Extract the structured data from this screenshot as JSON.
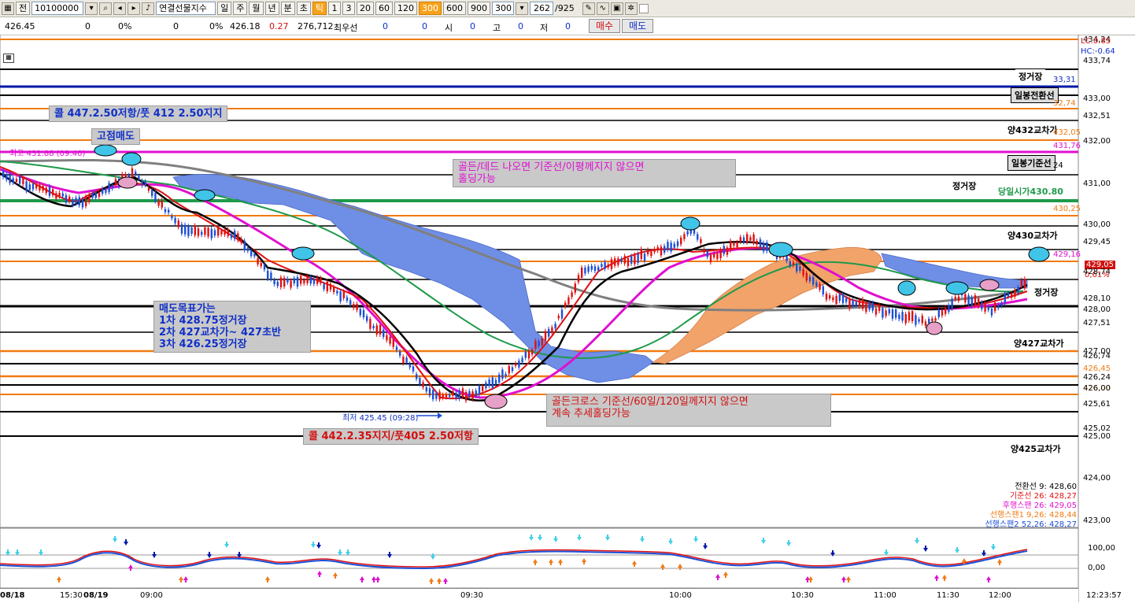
{
  "toolbar": {
    "items": [
      "전",
      "일",
      "주",
      "월",
      "년",
      "분",
      "초",
      "틱",
      "1",
      "3",
      "20",
      "60",
      "120",
      "300",
      "600",
      "900"
    ],
    "active_item": "300",
    "code_value": "10100000",
    "instrument_name": "연결선물지수",
    "interval_value": "300",
    "count_value": "262",
    "count_total": "/925"
  },
  "quote": {
    "price": "426.45",
    "v1": "0",
    "p1": "0%",
    "v2": "0",
    "p2": "0%",
    "price2": "426.18",
    "change": "0.27",
    "volume": "276,712",
    "label_best": "최우선",
    "best_a": "0",
    "best_b": "0",
    "label_open": "시",
    "open": "0",
    "label_high": "고",
    "high": "0",
    "label_low": "저",
    "low": "0",
    "buy": "매수",
    "sell": "매도"
  },
  "annotations": {
    "call_top": "콜 447.2.50저항/풋 412 2.50지지",
    "high_sell": "고점매도",
    "recent_high": "최고 431.88 (09:40)",
    "golden_dead": "골든/데드 나오면 기준선/이평께지지 않으면\n홀딩가능",
    "sell_targets": "매도목표가는\n1차 428.75정거장\n2차 427교차가~ 427초반\n3차 426.25정거장",
    "low_marker": "최저 425.45 (09:28)",
    "call_bottom": "콜 442.2.35지지/풋405 2.50저항",
    "golden_cross": "골든크로스 기준선/60일/120일께지지 않으면\n계속 추세홀딩가능"
  },
  "level_tags": {
    "station_top": "정거장",
    "ilbong_turn": "일봉전환선",
    "cross432": "양432교차가",
    "ilbong_base": "일봉기준선",
    "station_mid": "정거장",
    "day_open": "당일시가430.80",
    "cross430": "양430교차가",
    "station_right": "정거장",
    "cross427": "양427교차가",
    "cross425": "양425교차가"
  },
  "price_axis": {
    "lc": "LC:0.85",
    "hc": "HC:-0.64",
    "labels": [
      "434,24",
      "433,74",
      "33,31",
      "433,00",
      "32,74",
      "432,51",
      "432,05",
      "432,00",
      "431,76",
      "24",
      "431,00",
      "430,25",
      "430,00",
      "429,45",
      "429,16",
      "429,05",
      "0,61%",
      "428,74",
      "428,10",
      "428,00",
      "427,51",
      "427,00",
      "426,74",
      "426,45",
      "426,24",
      "426,00",
      "426,00",
      "425,61",
      "425,02",
      "425,00",
      "424,00",
      "423,00"
    ]
  },
  "oscillator_axis": [
    "100,00",
    "0,00"
  ],
  "legend": [
    "전환선 9: 428,60",
    "기준선 26: 428,27",
    "후행스팬 26: 429,05",
    "선행스팬1 9,26: 428,44",
    "선행스팬2 52,26: 428,27"
  ],
  "time_axis": {
    "labels": [
      "08/18",
      "15:30",
      "08/19",
      "09:00",
      "09:30",
      "10:00",
      "10:30",
      "11:00",
      "11:30",
      "12:00"
    ],
    "clock": "12:23:57"
  },
  "colors": {
    "orange": "#f07a12",
    "magenta": "#e010d0",
    "navy": "#0018a8",
    "green": "#1f9a4a",
    "red": "#e01010",
    "cloud_blue": "#6f8fe6",
    "cloud_orange": "#f2a36a",
    "candle_up": "#e01010",
    "candle_down": "#1c4fd6"
  }
}
